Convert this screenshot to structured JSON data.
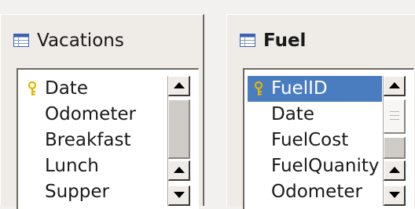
{
  "windows": [
    {
      "title": "Vacations",
      "fields": [
        {
          "name": "Date",
          "primary_key": true
        },
        {
          "name": "Odometer",
          "primary_key": false
        },
        {
          "name": "Breakfast",
          "primary_key": false
        },
        {
          "name": "Lunch",
          "primary_key": false
        },
        {
          "name": "Supper",
          "primary_key": false
        }
      ]
    },
    {
      "title": "Fuel",
      "fields": [
        {
          "name": "FuelID",
          "primary_key": true,
          "selected": true
        },
        {
          "name": "Date",
          "primary_key": false
        },
        {
          "name": "FuelCost",
          "primary_key": false
        },
        {
          "name": "FuelQuanity",
          "primary_key": false
        },
        {
          "name": "Odometer",
          "primary_key": false
        }
      ]
    }
  ],
  "colors": {
    "selection": "#4a7cc0",
    "key_icon": "#e2b400",
    "table_icon": "#3b63b0"
  },
  "icons": {
    "table": "table-icon",
    "key": "key-icon",
    "scroll_up": "arrow-up-icon",
    "scroll_down": "arrow-down-icon"
  }
}
